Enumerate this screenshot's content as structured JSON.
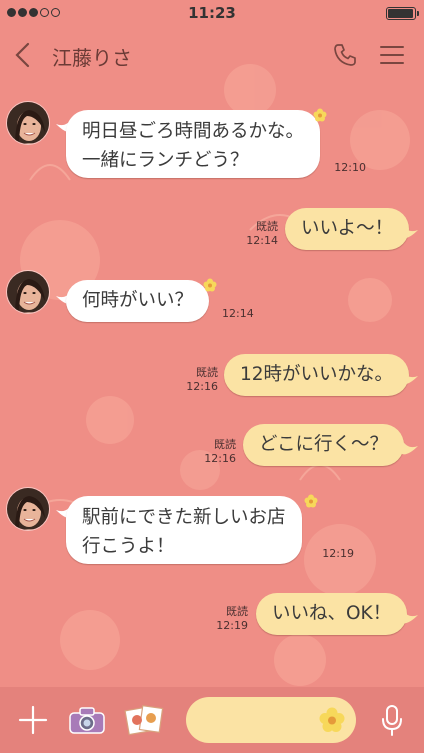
{
  "status": {
    "time": "11:23",
    "signal_filled": 3,
    "signal_total": 5,
    "battery_level": 0.95
  },
  "header": {
    "title": "江藤りさ",
    "back_icon": "chevron-left-icon",
    "call_icon": "phone-icon",
    "menu_icon": "hamburger-menu-icon"
  },
  "messages": [
    {
      "from": "friend",
      "lines": [
        "明日昼ごろ時間あるかな。",
        "一緒にランチどう？"
      ],
      "time": "12:10"
    },
    {
      "from": "me",
      "text": "いいよ〜！",
      "read": "既読",
      "time": "12:14"
    },
    {
      "from": "friend",
      "lines": [
        "何時がいい？"
      ],
      "time": "12:14"
    },
    {
      "from": "me",
      "text": "12時がいいかな。",
      "read": "既読",
      "time": "12:16"
    },
    {
      "from": "me",
      "text": "どこに行く〜？",
      "read": "既読",
      "time": "12:16"
    },
    {
      "from": "friend",
      "lines": [
        "駅前にできた新しいお店",
        "行こうよ！"
      ],
      "time": "12:19"
    },
    {
      "from": "me",
      "text": "いいね、OK！",
      "read": "既読",
      "time": "12:19"
    }
  ],
  "bottombar": {
    "icons": [
      "plus-icon",
      "camera-icon",
      "photo-album-icon",
      "emoji-icon",
      "microphone-icon"
    ]
  },
  "colors": {
    "background": "#ef8e86",
    "outgoing_bubble": "#fbe3a4",
    "incoming_bubble": "#ffffff",
    "bottom_bar": "#e4827c"
  }
}
